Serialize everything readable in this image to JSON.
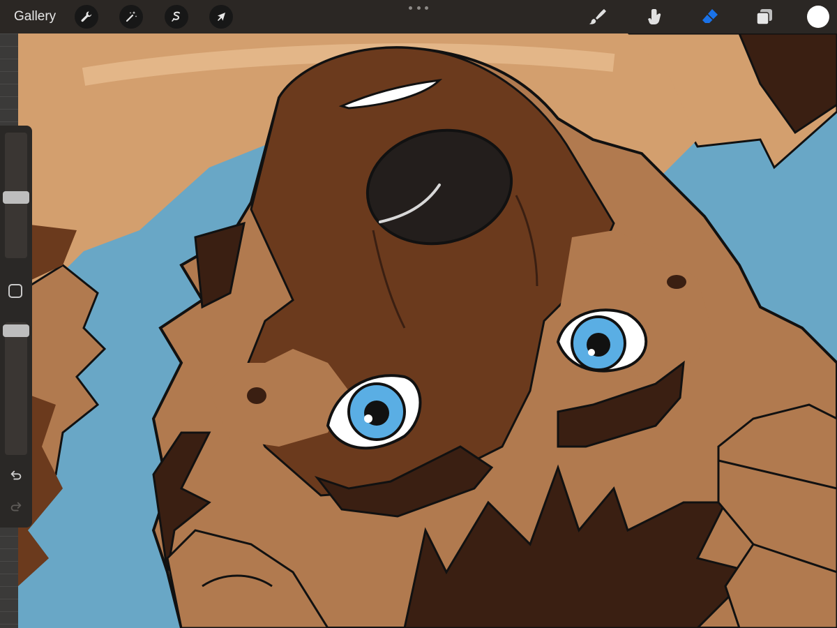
{
  "toolbar": {
    "gallery_label": "Gallery",
    "left_tools": [
      "wrench-icon",
      "magic-wand-icon",
      "selection-s-icon",
      "arrow-cursor-icon"
    ],
    "right_tools": [
      "brush-icon",
      "smudge-icon",
      "eraser-icon",
      "layers-icon"
    ],
    "active_tool": "eraser",
    "color": "#ffffff"
  },
  "sidebar": {
    "tools": [
      "brush-size-slider",
      "modify-button",
      "opacity-slider",
      "undo-icon",
      "redo-icon"
    ]
  },
  "colors": {
    "toolbar": "#2b2724",
    "accent_active": "#1a72e8",
    "canvas_bg": "#69a7c6",
    "fur_light": "#d39f6e",
    "fur_mid": "#b17a4f",
    "fur_dark": "#6b3a1d",
    "fur_darkest": "#3a1f12",
    "eye_iris": "#5aaee4"
  }
}
